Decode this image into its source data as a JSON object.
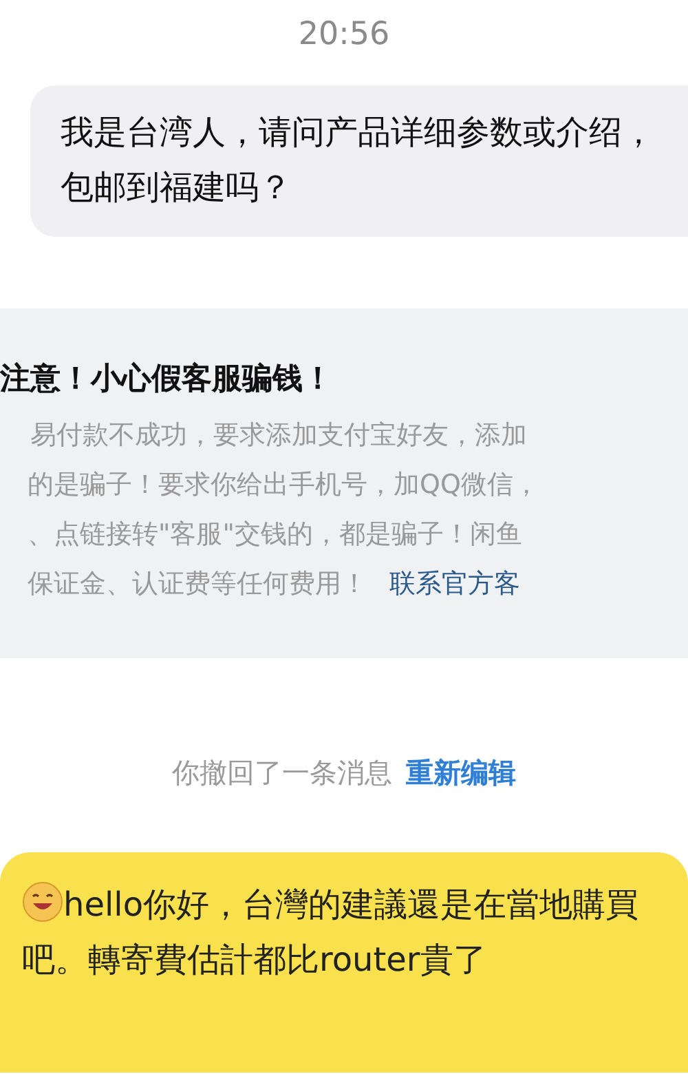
{
  "time": "20:56",
  "incoming_message": {
    "text": "我是台湾人，请问产品详细参数或介绍，包邮到福建吗？"
  },
  "warning_card": {
    "title": "注意！小心假客服骗钱！",
    "lines": [
      "易付款不成功，要求添加支付宝好友，添加",
      "的是骗子！要求你给出手机号，加QQ微信，",
      "、点链接转\"客服\"交钱的，都是骗子！闲鱼",
      "保证金、认证费等任何费用！"
    ],
    "link": "联系官方客"
  },
  "recall_notice": {
    "text": "你撤回了一条消息",
    "action": "重新编辑"
  },
  "outgoing_message": {
    "text": "hello你好，台灣的建議還是在當地購買吧。轉寄費估計都比router貴了"
  }
}
